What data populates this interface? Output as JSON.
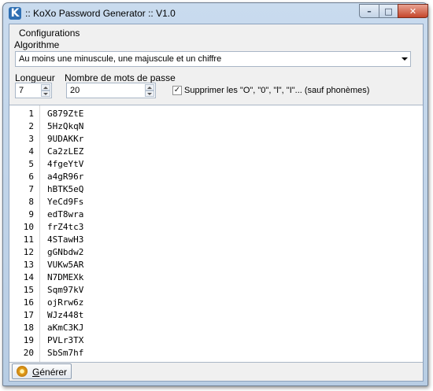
{
  "window": {
    "title": ":: KoXo Password Generator :: V1.0",
    "icon": "koxo-app-icon",
    "controls": {
      "minimize": "–",
      "maximize": "□",
      "close": "✕"
    }
  },
  "config": {
    "group_label": "Configurations",
    "algo_label": "Algorithme",
    "algo_value": "Au moins une minuscule, une majuscule et un chiffre",
    "length_label": "Longueur",
    "length_value": "7",
    "count_label": "Nombre de mots de passe",
    "count_value": "20",
    "exclude_checked": true,
    "exclude_check_glyph": "✓",
    "exclude_label": "Supprimer les \"O\", \"0\", \"l\", \"I\"... (sauf phonèmes)"
  },
  "results": {
    "rows": [
      {
        "num": "1",
        "pw": "G879ZtE"
      },
      {
        "num": "2",
        "pw": "5HzQkqN"
      },
      {
        "num": "3",
        "pw": "9UDAKKr"
      },
      {
        "num": "4",
        "pw": "Ca2zLEZ"
      },
      {
        "num": "5",
        "pw": "4fgeYtV"
      },
      {
        "num": "6",
        "pw": "a4gR96r"
      },
      {
        "num": "7",
        "pw": "hBTK5eQ"
      },
      {
        "num": "8",
        "pw": "YeCd9Fs"
      },
      {
        "num": "9",
        "pw": "edT8wra"
      },
      {
        "num": "10",
        "pw": "frZ4tc3"
      },
      {
        "num": "11",
        "pw": "4STawH3"
      },
      {
        "num": "12",
        "pw": "gGNbdw2"
      },
      {
        "num": "13",
        "pw": "VUKw5AR"
      },
      {
        "num": "14",
        "pw": "N7DMEXk"
      },
      {
        "num": "15",
        "pw": "Sqm97kV"
      },
      {
        "num": "16",
        "pw": "ojRrw6z"
      },
      {
        "num": "17",
        "pw": "WJz448t"
      },
      {
        "num": "18",
        "pw": "aKmC3KJ"
      },
      {
        "num": "19",
        "pw": "PVLr3TX"
      },
      {
        "num": "20",
        "pw": "SbSm7hf"
      }
    ]
  },
  "actions": {
    "generate_label": "Générer",
    "generate_icon": "gear-generate-icon"
  }
}
